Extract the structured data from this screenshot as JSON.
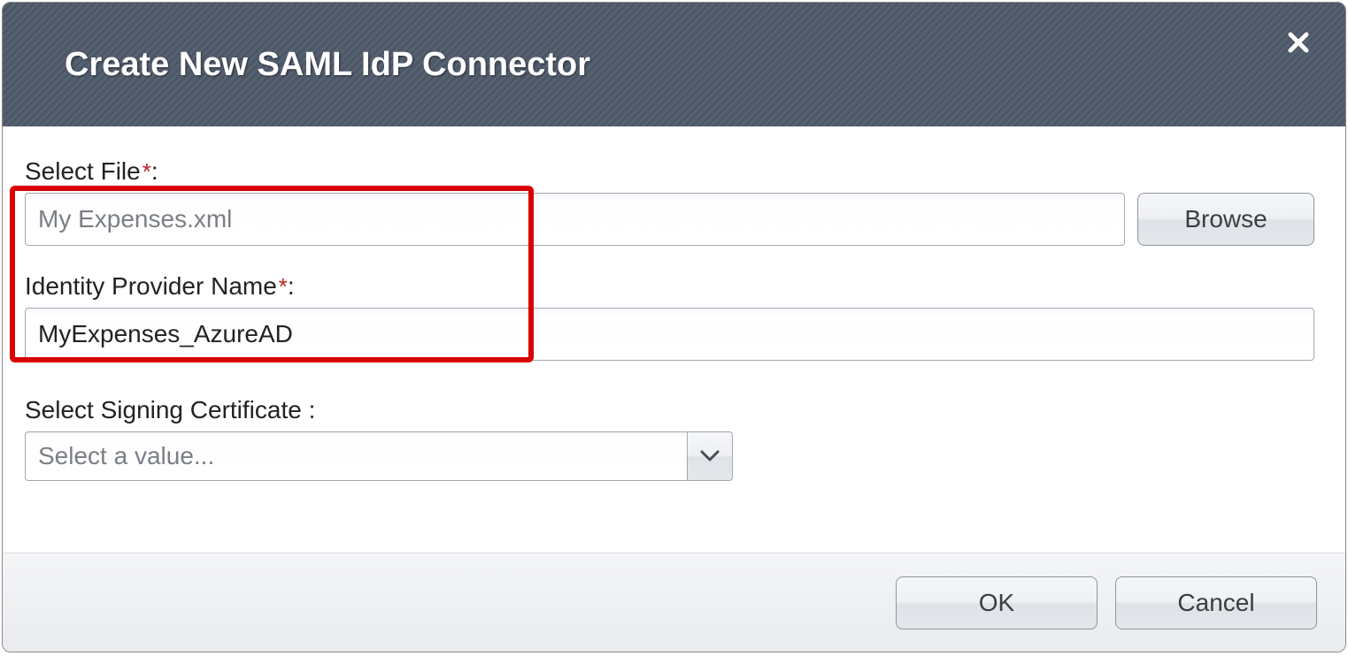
{
  "dialog": {
    "title": "Create New SAML IdP Connector",
    "close_tooltip": "Close"
  },
  "form": {
    "file_label": "Select File",
    "file_required_mark": "*",
    "file_label_suffix": ":",
    "file_value": "My Expenses.xml",
    "browse_label": "Browse",
    "idp_label": "Identity Provider Name",
    "idp_required_mark": "*",
    "idp_label_suffix": ":",
    "idp_value": "MyExpenses_AzureAD",
    "cert_label": "Select Signing Certificate  :",
    "cert_placeholder": "Select a value..."
  },
  "footer": {
    "ok_label": "OK",
    "cancel_label": "Cancel"
  }
}
